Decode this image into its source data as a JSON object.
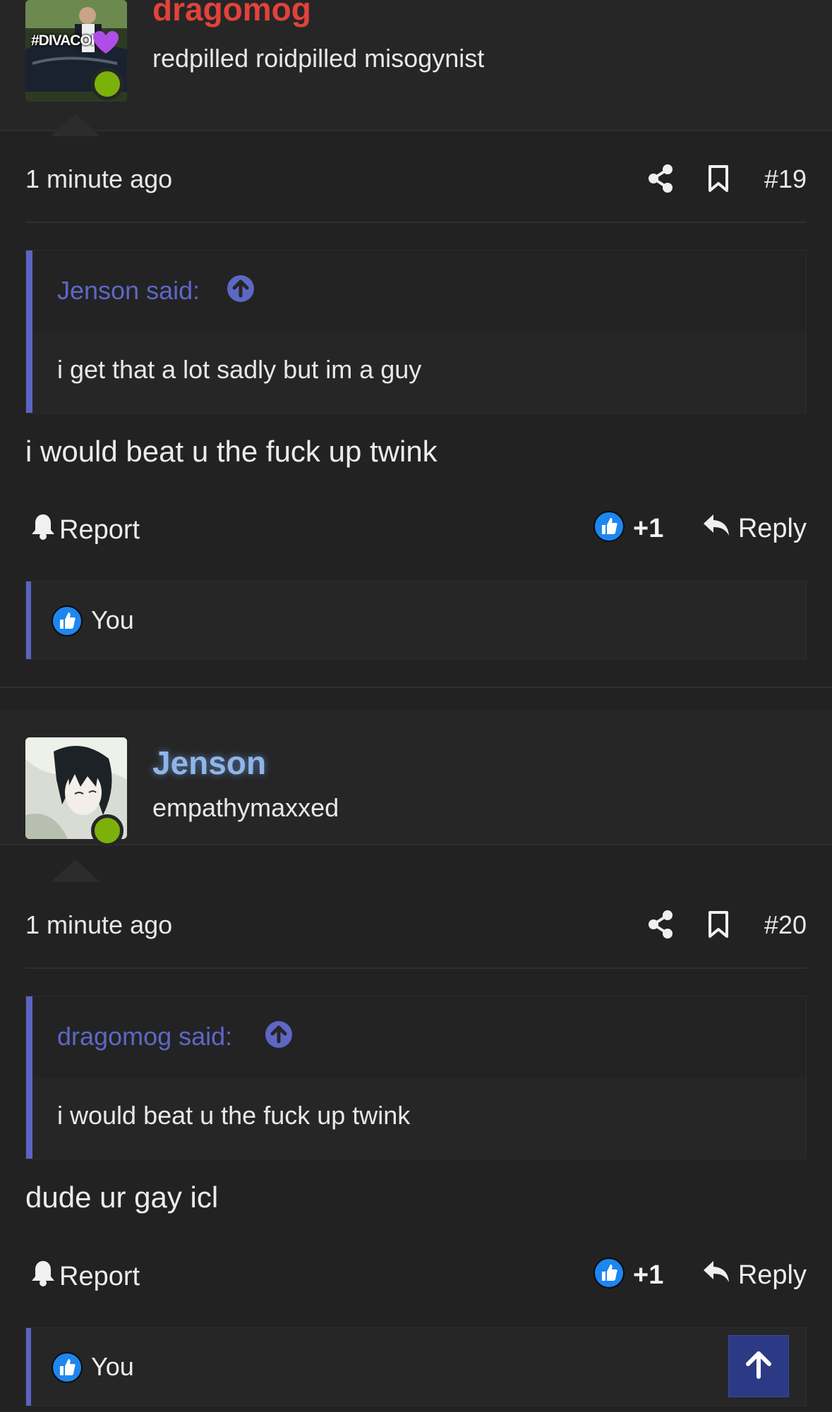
{
  "posts": [
    {
      "username": "dragomog",
      "username_color": "#e2423a",
      "user_title": "redpilled roidpilled misogynist",
      "avatar_caption": "#DIVACORE",
      "time": "1 minute ago",
      "number": "#19",
      "quote_author": "Jenson said:",
      "quote_text": "i get that a lot sadly but im a guy",
      "body": "i would beat u the fuck up twink",
      "report_label": "Report",
      "like_count": "+1",
      "reply_label": "Reply",
      "reaction_user": "You"
    },
    {
      "username": "Jenson",
      "username_color": "#8fb5e8",
      "user_title": "empathymaxxed",
      "time": "1 minute ago",
      "number": "#20",
      "quote_author": "dragomog said:",
      "quote_text": "i would beat u the fuck up twink",
      "body": "dude ur gay icl",
      "report_label": "Report",
      "like_count": "+1",
      "reply_label": "Reply",
      "reaction_user": "You"
    }
  ],
  "colors": {
    "background": "#222223",
    "quote_accent": "#5a64c4",
    "online": "#7cb10b",
    "like_blue": "#1877f2",
    "scroll_top_button": "#2c3a86"
  },
  "icons": [
    "share-icon",
    "bookmark-icon",
    "arrow-up-circle-icon",
    "bell-icon",
    "like-icon",
    "reply-arrow-icon",
    "arrow-up-icon"
  ]
}
